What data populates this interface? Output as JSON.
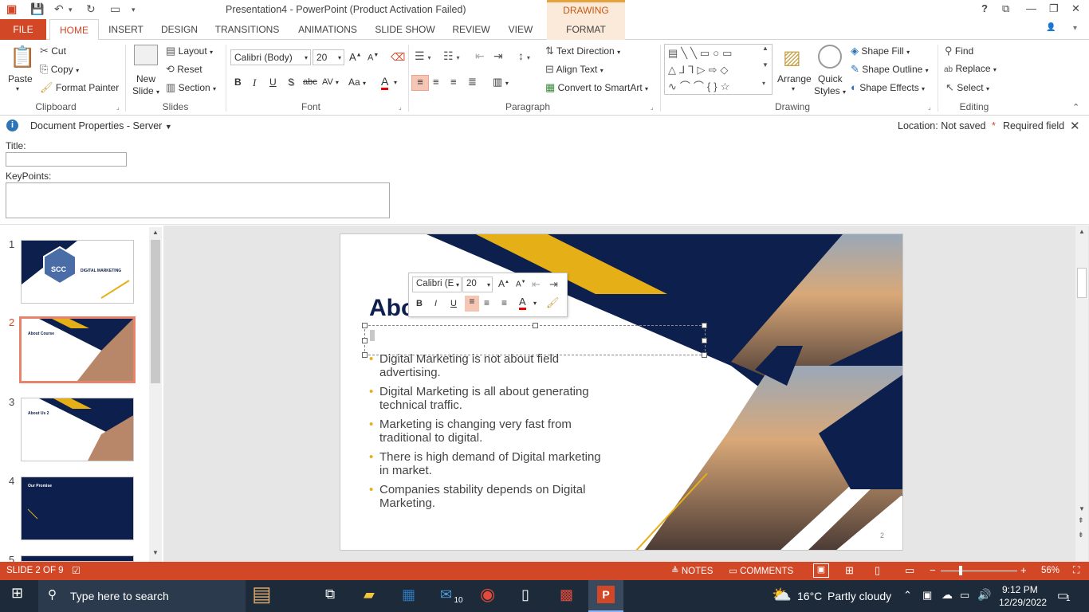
{
  "window": {
    "title": "Presentation4 - PowerPoint (Product Activation Failed)",
    "context_tools": "DRAWING TOOLS",
    "help": "?",
    "restore_ribbon": "⧉",
    "min": "—",
    "max": "❐",
    "close": "✕"
  },
  "tabs": [
    "FILE",
    "HOME",
    "INSERT",
    "DESIGN",
    "TRANSITIONS",
    "ANIMATIONS",
    "SLIDE SHOW",
    "REVIEW",
    "VIEW",
    "FORMAT"
  ],
  "ribbon": {
    "clipboard": {
      "paste": "Paste",
      "cut": "Cut",
      "copy": "Copy",
      "format_painter": "Format Painter",
      "label": "Clipboard"
    },
    "slides": {
      "new_slide": "New",
      "new_slide2": "Slide",
      "layout": "Layout",
      "reset": "Reset",
      "section": "Section",
      "label": "Slides"
    },
    "font": {
      "name": "Calibri (Body)",
      "size": "20",
      "label": "Font",
      "bold": "B",
      "italic": "I",
      "underline": "U",
      "shadow": "S",
      "strike": "abc",
      "spacing": "AV",
      "case": "Aa",
      "color": "A"
    },
    "paragraph": {
      "label": "Paragraph",
      "text_direction": "Text Direction",
      "align_text": "Align Text",
      "convert": "Convert to SmartArt"
    },
    "drawing": {
      "arrange": "Arrange",
      "quick_styles": "Quick",
      "quick_styles2": "Styles",
      "fill": "Shape Fill",
      "outline": "Shape Outline",
      "effects": "Shape Effects",
      "label": "Drawing"
    },
    "editing": {
      "find": "Find",
      "replace": "Replace",
      "select": "Select",
      "label": "Editing"
    }
  },
  "docprops": {
    "title": "Document Properties - Server",
    "location": "Location: Not saved",
    "required_star": "*",
    "required": "Required field",
    "title_label": "Title:",
    "keypoints_label": "KeyPoints:",
    "title_value": "",
    "keypoints_value": ""
  },
  "thumbs": [
    {
      "num": "1",
      "title": "DIGITAL MARKETING",
      "logo": "SCC"
    },
    {
      "num": "2",
      "title": "About Course"
    },
    {
      "num": "3",
      "title": "About Us 2"
    },
    {
      "num": "4",
      "title": "Our Promise"
    },
    {
      "num": "5",
      "title": ""
    }
  ],
  "slide": {
    "title": "About Course",
    "bullets": [
      "Digital Marketing is not about field advertising.",
      "Digital Marketing is all about generating technical traffic.",
      "Marketing is changing very fast from traditional to digital.",
      "There is high demand of Digital marketing in market.",
      "Companies stability depends on Digital Marketing."
    ],
    "page_number": "2"
  },
  "mini_toolbar": {
    "font": "Calibri (E",
    "size": "20"
  },
  "status": {
    "slide_info": "SLIDE 2 OF 9",
    "notes": "NOTES",
    "comments": "COMMENTS",
    "zoom": "56%"
  },
  "taskbar": {
    "search": "Type here to search",
    "weather_temp": "16°C",
    "weather_desc": "Partly cloudy",
    "time": "9:12 PM",
    "date": "12/29/2022",
    "mail_badge": "10",
    "notif_badge": "1"
  },
  "colors": {
    "accent": "#d24726",
    "navy": "#0c1f4d",
    "gold": "#e5b017"
  }
}
